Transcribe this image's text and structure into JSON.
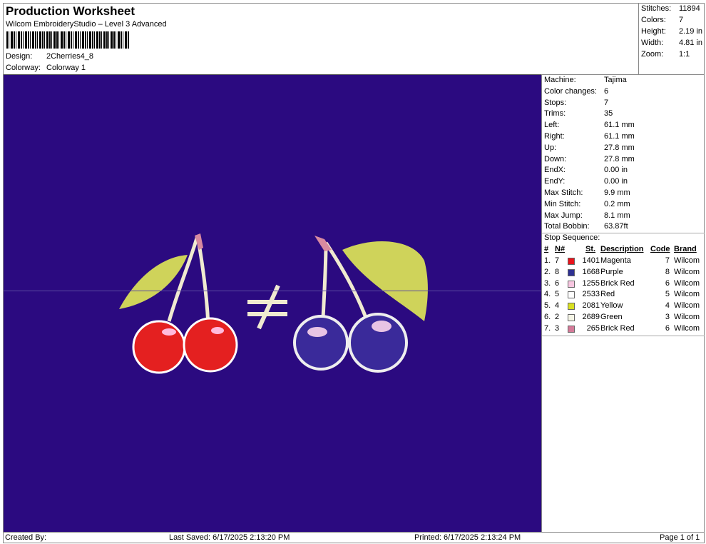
{
  "header": {
    "title": "Production Worksheet",
    "subtitle": "Wilcom EmbroideryStudio – Level 3 Advanced",
    "design_label": "Design:",
    "design": "2Cherries4_8",
    "colorway_label": "Colorway:",
    "colorway": "Colorway 1"
  },
  "stats": [
    {
      "k": "Stitches:",
      "v": "11894"
    },
    {
      "k": "Colors:",
      "v": "7"
    },
    {
      "k": "Height:",
      "v": "2.19 in"
    },
    {
      "k": "Width:",
      "v": "4.81 in"
    },
    {
      "k": "Zoom:",
      "v": "1:1"
    }
  ],
  "machine": [
    {
      "k": "Machine:",
      "v": "Tajima"
    },
    {
      "k": "Color changes:",
      "v": "6"
    },
    {
      "k": "Stops:",
      "v": "7"
    },
    {
      "k": "Trims:",
      "v": "35"
    },
    {
      "k": "Left:",
      "v": "61.1 mm"
    },
    {
      "k": "Right:",
      "v": "61.1 mm"
    },
    {
      "k": "Up:",
      "v": "27.8 mm"
    },
    {
      "k": "Down:",
      "v": "27.8 mm"
    },
    {
      "k": "EndX:",
      "v": "0.00 in"
    },
    {
      "k": "EndY:",
      "v": "0.00 in"
    },
    {
      "k": "Max Stitch:",
      "v": "9.9 mm"
    },
    {
      "k": "Min Stitch:",
      "v": "0.2 mm"
    },
    {
      "k": "Max Jump:",
      "v": "8.1 mm"
    },
    {
      "k": "Total Bobbin:",
      "v": "63.87ft"
    }
  ],
  "stop_sequence": {
    "label": "Stop Sequence:",
    "headers": {
      "num": "#",
      "n": "N#",
      "st": "St.",
      "desc": "Description",
      "code": "Code",
      "brand": "Brand"
    },
    "rows": [
      {
        "num": "1.",
        "n": "7",
        "color": "#e8141c",
        "st": "1401",
        "desc": "Magenta",
        "code": "7",
        "brand": "Wilcom"
      },
      {
        "num": "2.",
        "n": "8",
        "color": "#2e3192",
        "st": "1668",
        "desc": "Purple",
        "code": "8",
        "brand": "Wilcom"
      },
      {
        "num": "3.",
        "n": "6",
        "color": "#f7c6e0",
        "st": "1255",
        "desc": "Brick Red",
        "code": "6",
        "brand": "Wilcom"
      },
      {
        "num": "4.",
        "n": "5",
        "color": "#ffffff",
        "st": "2533",
        "desc": "Red",
        "code": "5",
        "brand": "Wilcom"
      },
      {
        "num": "5.",
        "n": "4",
        "color": "#d9e021",
        "st": "2081",
        "desc": "Yellow",
        "code": "4",
        "brand": "Wilcom"
      },
      {
        "num": "6.",
        "n": "2",
        "color": "#f5f5e6",
        "st": "2689",
        "desc": "Green",
        "code": "3",
        "brand": "Wilcom"
      },
      {
        "num": "7.",
        "n": "3",
        "color": "#d47a98",
        "st": "265",
        "desc": "Brick Red",
        "code": "6",
        "brand": "Wilcom"
      }
    ]
  },
  "footer": {
    "created": "Created By:",
    "saved": "Last Saved: 6/17/2025 2:13:20 PM",
    "printed": "Printed: 6/17/2025 2:13:24 PM",
    "page": "Page 1 of 1"
  }
}
